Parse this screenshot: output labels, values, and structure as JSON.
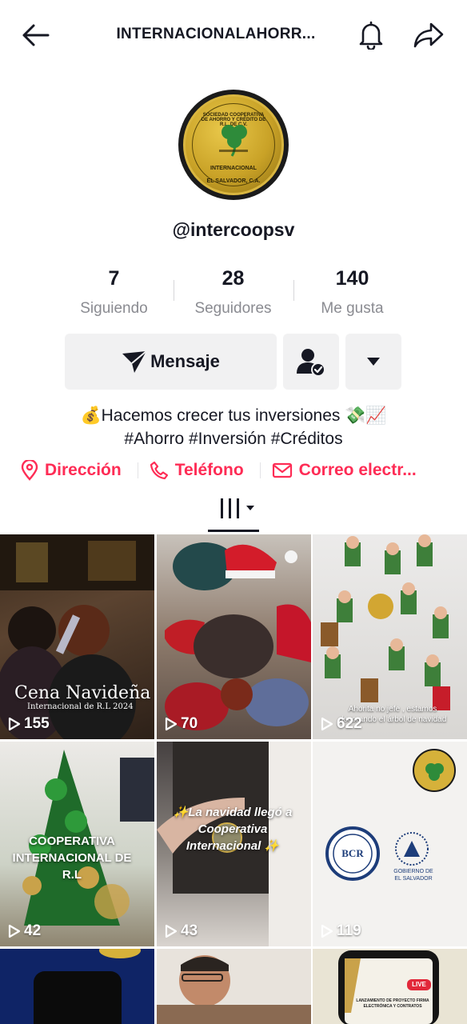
{
  "header": {
    "title": "INTERNACIONALAHORR...",
    "back_icon": "arrow-left-icon",
    "bell_icon": "bell-icon",
    "share_icon": "share-arrow-icon"
  },
  "profile": {
    "avatar_text_top": "SOCIEDAD COOPERATIVA DE AHORRO Y CRÉDITO DE R.L. DE C.V.",
    "avatar_text_mid": "INTERNACIONAL",
    "avatar_text_bottom": "EL SALVADOR, C.A.",
    "username": "@intercoopsv"
  },
  "stats": [
    {
      "value": "7",
      "label": "Siguiendo"
    },
    {
      "value": "28",
      "label": "Seguidores"
    },
    {
      "value": "140",
      "label": "Me gusta"
    }
  ],
  "actions": {
    "message_label": "Mensaje",
    "message_icon": "send-icon",
    "follow_icon": "person-check-icon",
    "more_icon": "caret-down-icon"
  },
  "bio": {
    "line1": "💰Hacemos crecer tus inversiones 💸📈",
    "line2": "#Ahorro #Inversión #Créditos"
  },
  "links": [
    {
      "label": "Dirección",
      "icon": "location-pin-icon"
    },
    {
      "label": "Teléfono",
      "icon": "phone-icon"
    },
    {
      "label": "Correo electr...",
      "icon": "mail-icon"
    }
  ],
  "colors": {
    "accent": "#fe2c55",
    "text": "#161823",
    "muted": "#8a8b91"
  },
  "videos": [
    {
      "views": "155",
      "caption": "Cena Navideña",
      "subcaption": "Internacional de R.L 2024"
    },
    {
      "views": "70"
    },
    {
      "views": "622",
      "caption": "Ahorita no jefe , estamos decorando el árbol de navidad"
    },
    {
      "views": "42",
      "caption": "COOPERATIVA INTERNACIONAL DE R.L"
    },
    {
      "views": "43",
      "caption": "✨La navidad llegó a Cooperativa Internacional ✨"
    },
    {
      "views": "119",
      "caption": "BCR",
      "subcaption": "GOBIERNO DE EL SALVADOR"
    },
    {},
    {},
    {
      "caption": "LIVE",
      "subcaption": "LANZAMIENTO DE PROYECTO FIRMA ELECTRÓNICA Y CONTRATOS"
    }
  ]
}
